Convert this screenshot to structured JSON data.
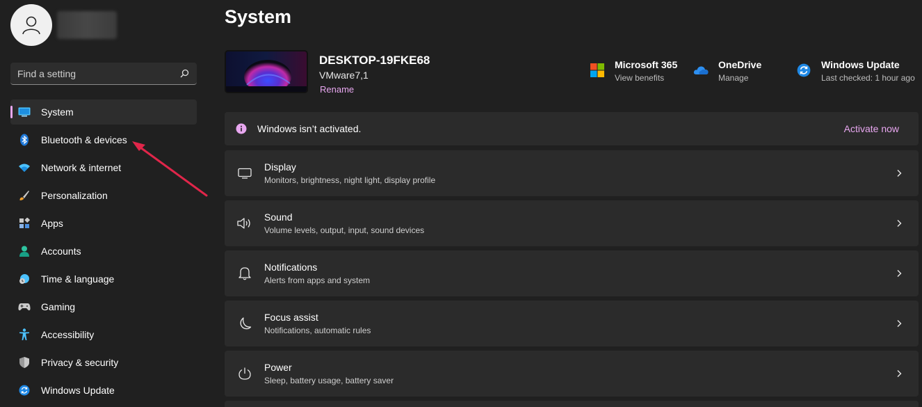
{
  "sidebar": {
    "search_placeholder": "Find a setting",
    "items": [
      {
        "label": "System",
        "icon": "monitor-icon",
        "active": true
      },
      {
        "label": "Bluetooth & devices",
        "icon": "bluetooth-icon"
      },
      {
        "label": "Network & internet",
        "icon": "wifi-icon"
      },
      {
        "label": "Personalization",
        "icon": "brush-icon"
      },
      {
        "label": "Apps",
        "icon": "apps-icon"
      },
      {
        "label": "Accounts",
        "icon": "person-icon"
      },
      {
        "label": "Time & language",
        "icon": "clock-globe-icon"
      },
      {
        "label": "Gaming",
        "icon": "gamepad-icon"
      },
      {
        "label": "Accessibility",
        "icon": "accessibility-icon"
      },
      {
        "label": "Privacy & security",
        "icon": "shield-icon"
      },
      {
        "label": "Windows Update",
        "icon": "update-icon"
      }
    ]
  },
  "main": {
    "title": "System",
    "device": {
      "name": "DESKTOP-19FKE68",
      "model": "VMware7,1",
      "rename_label": "Rename"
    },
    "quick_links": [
      {
        "title": "Microsoft 365",
        "subtitle": "View benefits",
        "icon": "microsoft-logo-icon"
      },
      {
        "title": "OneDrive",
        "subtitle": "Manage",
        "icon": "cloud-icon"
      },
      {
        "title": "Windows Update",
        "subtitle": "Last checked: 1 hour ago",
        "icon": "update-icon"
      }
    ],
    "activation": {
      "message": "Windows isn’t activated.",
      "action": "Activate now"
    },
    "cards": [
      {
        "title": "Display",
        "subtitle": "Monitors, brightness, night light, display profile",
        "icon": "display-icon"
      },
      {
        "title": "Sound",
        "subtitle": "Volume levels, output, input, sound devices",
        "icon": "speaker-icon"
      },
      {
        "title": "Notifications",
        "subtitle": "Alerts from apps and system",
        "icon": "bell-icon"
      },
      {
        "title": "Focus assist",
        "subtitle": "Notifications, automatic rules",
        "icon": "moon-icon"
      },
      {
        "title": "Power",
        "subtitle": "Sleep, battery usage, battery saver",
        "icon": "power-icon"
      }
    ]
  },
  "colors": {
    "accent": "#e8a7f0",
    "background": "#202020",
    "card": "#2b2b2b",
    "annotation_arrow": "#e0264a"
  }
}
